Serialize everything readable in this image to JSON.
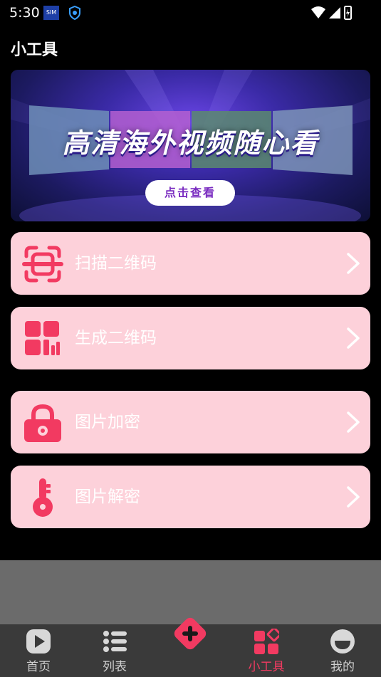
{
  "status_bar": {
    "time": "5:30",
    "sim_label": "SIM"
  },
  "header": {
    "title": "小工具"
  },
  "banner": {
    "headline": "高清海外视频随心看",
    "button_label": "点击查看"
  },
  "tools": [
    {
      "label": "扫描二维码",
      "icon": "scan-qr-icon"
    },
    {
      "label": "生成二维码",
      "icon": "qr-code-icon"
    },
    {
      "label": "图片加密",
      "icon": "lock-icon"
    },
    {
      "label": "图片解密",
      "icon": "key-icon"
    }
  ],
  "tab_bar": {
    "items": [
      {
        "label": "首页",
        "icon": "play-icon",
        "active": false
      },
      {
        "label": "列表",
        "icon": "list-icon",
        "active": false
      },
      {
        "label": "小工具",
        "icon": "tools-grid-icon",
        "active": true
      },
      {
        "label": "我的",
        "icon": "profile-icon",
        "active": false
      }
    ],
    "fab_icon": "plus-icon"
  },
  "colors": {
    "accent": "#f23a61",
    "card_bg": "#fdd1da",
    "tab_bg": "#3a3a3a",
    "ad_bg": "#6b6b6b"
  }
}
